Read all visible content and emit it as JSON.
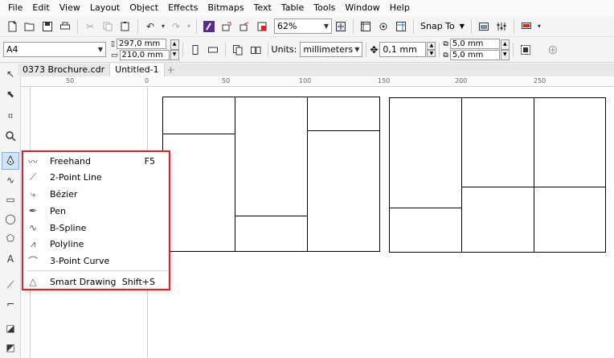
{
  "menubar": [
    "File",
    "Edit",
    "View",
    "Layout",
    "Object",
    "Effects",
    "Bitmaps",
    "Text",
    "Table",
    "Tools",
    "Window",
    "Help"
  ],
  "toolbar1": {
    "zoom": "62%",
    "snap_label": "Snap To"
  },
  "toolbar2": {
    "page_size": "A4",
    "width": "297,0 mm",
    "height": "210,0 mm",
    "units_label": "Units:",
    "units_value": "millimeters",
    "nudge": "0,1 mm",
    "dup_x": "5,0 mm",
    "dup_y": "5,0 mm"
  },
  "tabs": [
    "0373 Brochure.cdr",
    "Untitled-1"
  ],
  "ruler": {
    "top": [
      "50",
      "0",
      "50",
      "100",
      "150",
      "200",
      "250"
    ]
  },
  "flyout": {
    "items": [
      {
        "label": "Freehand",
        "shortcut": "F5",
        "icon": "freehand-icon"
      },
      {
        "label": "2-Point Line",
        "shortcut": "",
        "icon": "two-point-line-icon"
      },
      {
        "label": "Bézier",
        "shortcut": "",
        "icon": "bezier-icon"
      },
      {
        "label": "Pen",
        "shortcut": "",
        "icon": "pen-icon"
      },
      {
        "label": "B-Spline",
        "shortcut": "",
        "icon": "b-spline-icon"
      },
      {
        "label": "Polyline",
        "shortcut": "",
        "icon": "polyline-icon"
      },
      {
        "label": "3-Point Curve",
        "shortcut": "",
        "icon": "three-point-curve-icon"
      },
      {
        "label": "Smart Drawing",
        "shortcut": "Shift+S",
        "icon": "smart-drawing-icon"
      }
    ]
  },
  "colors": {
    "highlight_border": "#e01e2a",
    "selected_tool_bg": "#cde4fb"
  }
}
